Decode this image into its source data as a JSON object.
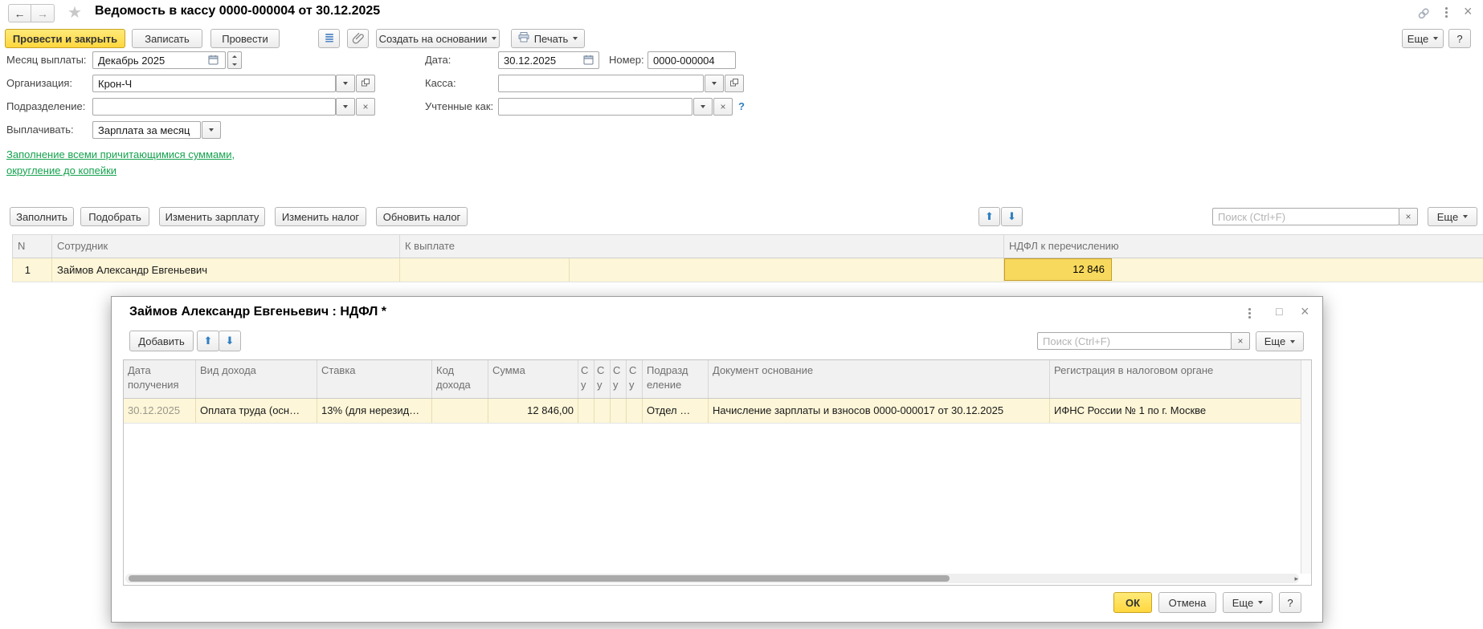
{
  "colors": {
    "accent_yellow": "#ffd73e",
    "row_highlight": "#fdf6d8",
    "selected_cell": "#f7d95e",
    "selected_cell_border": "#c49c2b",
    "link_green": "#16a24f",
    "arrow_blue": "#2e7fc2"
  },
  "icons": {
    "back": "←",
    "forward": "→",
    "star": "★",
    "close": "×",
    "maximize": "□",
    "up": "⬆",
    "down": "⬇",
    "clear": "×",
    "scroll_right": "▸"
  },
  "window": {
    "title": "Ведомость в кассу 0000-000004 от 30.12.2025"
  },
  "toolbar": {
    "post_and_close": "Провести и закрыть",
    "write": "Записать",
    "post": "Провести",
    "create_on_base": "Создать на основании",
    "print": "Печать",
    "more": "Еще",
    "help": "?"
  },
  "form": {
    "month_label": "Месяц выплаты:",
    "month_value": "Декабрь 2025",
    "org_label": "Организация:",
    "org_value": "Крон-Ч",
    "dept_label": "Подразделение:",
    "dept_value": "",
    "pay_label": "Выплачивать:",
    "pay_value": "Зарплата за месяц",
    "date_label": "Дата:",
    "date_value": "30.12.2025",
    "number_label": "Номер:",
    "number_value": "0000-000004",
    "cashbox_label": "Касса:",
    "cashbox_value": "",
    "accounted_label": "Учтенные как:",
    "accounted_value": "",
    "accounted_help": "?",
    "fill_link": "Заполнение всеми причитающимися суммами, округление до копейки"
  },
  "cmdbar": {
    "fill": "Заполнить",
    "pick": "Подобрать",
    "change_salary": "Изменить зарплату",
    "change_tax": "Изменить налог",
    "update_tax": "Обновить налог",
    "search_placeholder": "Поиск (Ctrl+F)",
    "more": "Еще"
  },
  "main_table": {
    "headers": [
      "N",
      "Сотрудник",
      "К выплате",
      "НДФЛ к перечислению"
    ],
    "row": {
      "num": "1",
      "employee": "Займов Александр Евгеньевич",
      "to_pay": "",
      "ndfl": "12 846"
    }
  },
  "modal": {
    "title": "Займов Александр Евгеньевич : НДФЛ *",
    "add": "Добавить",
    "search_placeholder": "Поиск (Ctrl+F)",
    "more": "Еще",
    "table": {
      "headers": [
        "Дата получения",
        "Вид дохода",
        "Ставка",
        "Код дохода",
        "Сумма",
        "С у",
        "С у",
        "С у",
        "С у",
        "Подразд еление",
        "Документ основание",
        "Регистрация в налоговом органе"
      ],
      "row": [
        "30.12.2025",
        "Оплата труда (осн…",
        "13% (для нерезид…",
        "",
        "12 846,00",
        "",
        "",
        "",
        "",
        "Отдел …",
        "Начисление зарплаты и взносов 0000-000017 от 30.12.2025",
        "ИФНС России № 1 по г. Москве"
      ]
    },
    "ok": "ОК",
    "cancel": "Отмена",
    "help": "?"
  }
}
